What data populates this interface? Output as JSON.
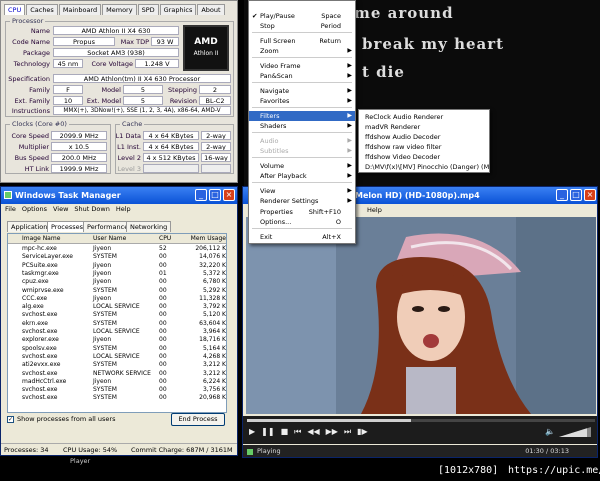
{
  "cpuz": {
    "tabs": [
      "CPU",
      "Caches",
      "Mainboard",
      "Memory",
      "SPD",
      "Graphics",
      "About"
    ],
    "processor_label": "Processor",
    "name_label": "Name",
    "name": "AMD Athlon II X4 630",
    "codename_label": "Code Name",
    "codename": "Propus",
    "maxtdp_label": "Max TDP",
    "maxtdp": "93 W",
    "package_label": "Package",
    "package": "Socket AM3 (938)",
    "tech_label": "Technology",
    "tech": "45 nm",
    "corevolt_label": "Core Voltage",
    "corevolt": "1.248 V",
    "spec_label": "Specification",
    "spec": "AMD Athlon(tm) II X4 630 Processor",
    "family_label": "Family",
    "family": "F",
    "model_label": "Model",
    "model": "5",
    "stepping_label": "Stepping",
    "stepping": "2",
    "extfamily_label": "Ext. Family",
    "extfamily": "10",
    "extmodel_label": "Ext. Model",
    "extmodel": "5",
    "revision_label": "Revision",
    "revision": "BL-C2",
    "instr_label": "Instructions",
    "instr": "MMX(+), 3DNow!(+), SSE (1, 2, 3, 4A), x86-64, AMD-V",
    "logo_text": "AMD Athlon II",
    "clocks_label": "Clocks (Core #0)",
    "corespeed_label": "Core Speed",
    "corespeed": "2099.9 MHz",
    "multiplier_label": "Multiplier",
    "multiplier": "x 10.5",
    "busspeed_label": "Bus Speed",
    "busspeed": "200.0 MHz",
    "htlink_label": "HT Link",
    "htlink": "1999.9 MHz",
    "cache_label": "Cache",
    "l1d_label": "L1 Data",
    "l1d": "4 x 64 KBytes",
    "l1d_way": "2-way",
    "l1i_label": "L1 Inst.",
    "l1i": "4 x 64 KBytes",
    "l1i_way": "2-way",
    "l2_label": "Level 2",
    "l2": "4 x 512 KBytes",
    "l2_way": "16-way",
    "l3_label": "Level 3"
  },
  "taskmgr": {
    "title": "Windows Task Manager",
    "menu": [
      "File",
      "Options",
      "View",
      "Shut Down",
      "Help"
    ],
    "tabs": [
      "Applications",
      "Processes",
      "Performance",
      "Networking"
    ],
    "headers": [
      "Image Name",
      "User Name",
      "CPU",
      "Mem Usage"
    ],
    "rows": [
      [
        "mpc-hc.exe",
        "Jiyeon",
        "52",
        "206,112 K"
      ],
      [
        "ServiceLayer.exe",
        "SYSTEM",
        "00",
        "14,076 K"
      ],
      [
        "PCSuite.exe",
        "Jiyeon",
        "00",
        "32,220 K"
      ],
      [
        "taskmgr.exe",
        "Jiyeon",
        "01",
        "5,372 K"
      ],
      [
        "cpuz.exe",
        "Jiyeon",
        "00",
        "6,780 K"
      ],
      [
        "wmiprvse.exe",
        "SYSTEM",
        "00",
        "5,292 K"
      ],
      [
        "CCC.exe",
        "Jiyeon",
        "00",
        "11,328 K"
      ],
      [
        "alg.exe",
        "LOCAL SERVICE",
        "00",
        "3,792 K"
      ],
      [
        "svchost.exe",
        "SYSTEM",
        "00",
        "5,120 K"
      ],
      [
        "ekrn.exe",
        "SYSTEM",
        "00",
        "63,604 K"
      ],
      [
        "svchost.exe",
        "LOCAL SERVICE",
        "00",
        "3,964 K"
      ],
      [
        "explorer.exe",
        "Jiyeon",
        "00",
        "18,716 K"
      ],
      [
        "spoolsv.exe",
        "SYSTEM",
        "00",
        "5,164 K"
      ],
      [
        "svchost.exe",
        "LOCAL SERVICE",
        "00",
        "4,268 K"
      ],
      [
        "ati2evxx.exe",
        "SYSTEM",
        "00",
        "3,212 K"
      ],
      [
        "svchost.exe",
        "NETWORK SERVICE",
        "00",
        "3,212 K"
      ],
      [
        "madHcCtrl.exe",
        "Jiyeon",
        "00",
        "6,224 K"
      ],
      [
        "svchost.exe",
        "SYSTEM",
        "00",
        "3,756 K"
      ],
      [
        "svchost.exe",
        "SYSTEM",
        "00",
        "20,968 K"
      ]
    ],
    "show_all_label": "Show processes from all users",
    "end_process": "End Process",
    "processes": "Processes: 34",
    "cpu_usage": "CPU Usage: 54%",
    "commit": "Commit Charge: 687M / 3161M"
  },
  "player": {
    "title": "Melon HD) (HD-1080p).mp4",
    "help_menu": "Help",
    "lyrics": [
      "me around",
      "break my heart",
      "t die"
    ],
    "status": "Playing",
    "time": "01:30 / 03:13",
    "taskbar_label": "Player"
  },
  "menu": {
    "items": [
      {
        "label": "Play/Pause",
        "shortcut": "Space",
        "checked": true
      },
      {
        "label": "Stop",
        "shortcut": "Period"
      },
      {
        "label": "Full Screen",
        "shortcut": "Return"
      },
      {
        "label": "Zoom",
        "arrow": true
      },
      {
        "label": "Video Frame",
        "arrow": true
      },
      {
        "label": "Pan&Scan",
        "arrow": true
      },
      {
        "label": "Navigate",
        "arrow": true
      },
      {
        "label": "Favorites",
        "arrow": true
      },
      {
        "label": "Filters",
        "arrow": true,
        "highlight": true
      },
      {
        "label": "Shaders",
        "arrow": true
      },
      {
        "label": "Audio",
        "arrow": true,
        "disabled": true
      },
      {
        "label": "Subtitles",
        "arrow": true,
        "disabled": true
      },
      {
        "label": "Volume",
        "arrow": true
      },
      {
        "label": "After Playback",
        "arrow": true
      },
      {
        "label": "View",
        "arrow": true
      },
      {
        "label": "Renderer Settings",
        "arrow": true
      },
      {
        "label": "Properties",
        "shortcut": "Shift+F10"
      },
      {
        "label": "Options...",
        "shortcut": "O"
      },
      {
        "label": "Exit",
        "shortcut": "Alt+X"
      }
    ],
    "filters": [
      "ReClock Audio Renderer",
      "madVR Renderer",
      "ffdshow Audio Decoder",
      "ffdshow raw video filter",
      "ffdshow Video Decoder",
      "D:\\MV\\f(x)\\[MV] Pinocchio (Danger) (Melo..."
    ]
  },
  "footer": {
    "resolution": "[1012x780]",
    "url": "https://upic.me/"
  },
  "colors": {
    "accent": "#316ac5",
    "titlebar": "#0a52d6"
  }
}
